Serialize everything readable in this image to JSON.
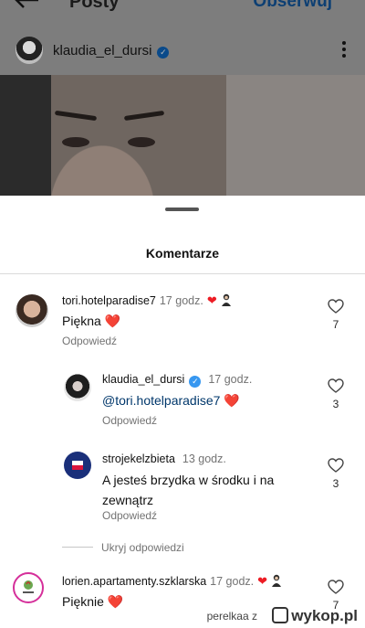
{
  "header": {
    "title": "Posty",
    "follow_label": "Obserwuj"
  },
  "post": {
    "username": "klaudia_el_dursi",
    "verified": true
  },
  "sheet": {
    "title": "Komentarze",
    "comments": [
      {
        "username": "tori.hotelparadise7",
        "time": "17 godz.",
        "text": "Piękna ❤️",
        "reply_label": "Odpowiedź",
        "likes": "7"
      },
      {
        "username": "klaudia_el_dursi",
        "time": "17 godz.",
        "mention": "@tori.hotelparadise7",
        "text": "❤️",
        "reply_label": "Odpowiedź",
        "likes": "3",
        "verified": true
      },
      {
        "username": "strojekelzbieta",
        "time": "13 godz.",
        "text": "A jesteś brzydka w środku i na zewnątrz",
        "reply_label": "Odpowiedź",
        "likes": "3"
      },
      {
        "username": "lorien.apartamenty.szklarska",
        "time": "17 godz.",
        "text": "Pięknie ❤️",
        "likes": "7"
      }
    ],
    "hide_replies_label": "Ukryj odpowiedzi"
  },
  "watermark": {
    "user": "perelkaa",
    "sep": "z",
    "site": "wykop.pl"
  },
  "colors": {
    "accent": "#3797f0",
    "heart": "#ed1c24",
    "mention": "#00376b",
    "muted": "#737373"
  }
}
